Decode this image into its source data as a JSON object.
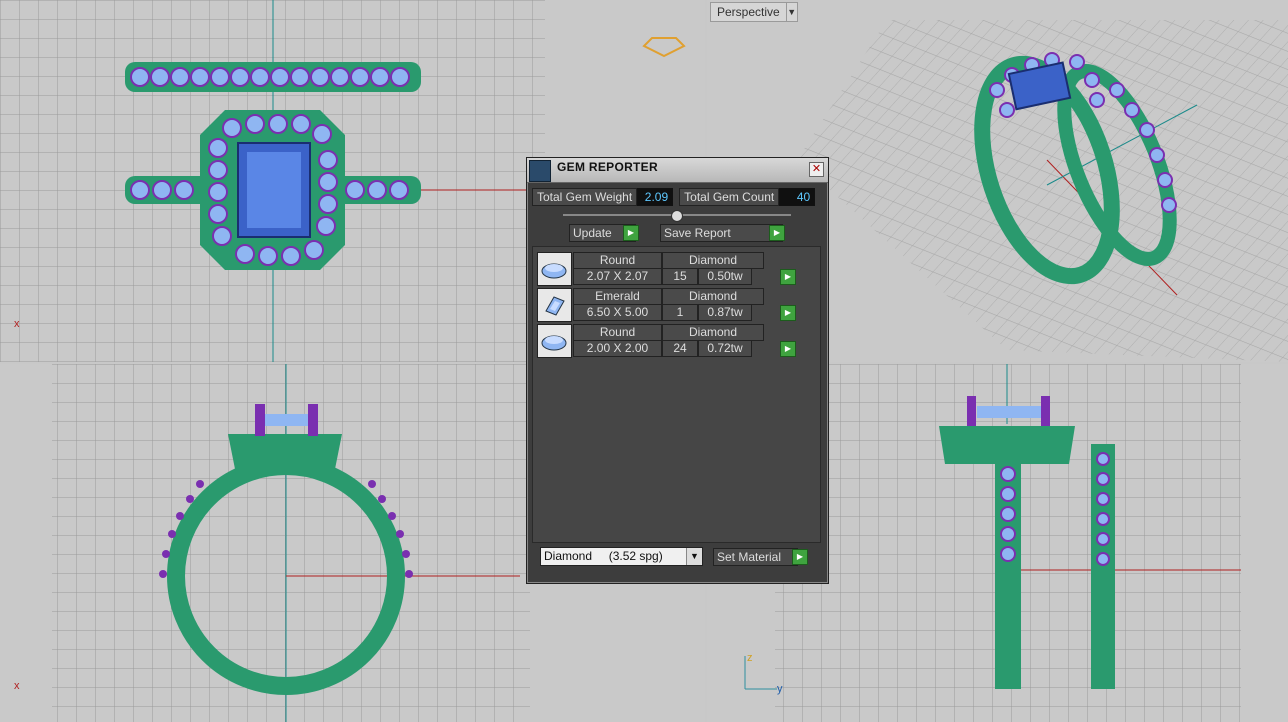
{
  "viewports": {
    "perspective_label": "Perspective",
    "axis_x": "x",
    "axis_y": "y",
    "axis_z": "z"
  },
  "gem_reporter": {
    "title": "GEM REPORTER",
    "total_weight_label": "Total Gem Weight",
    "total_weight_value": "2.09",
    "total_count_label": "Total Gem Count",
    "total_count_value": "40",
    "update_label": "Update",
    "save_report_label": "Save Report",
    "gems": [
      {
        "shape": "Round",
        "material": "Diamond",
        "size": "2.07 X 2.07",
        "count": "15",
        "weight": "0.50tw"
      },
      {
        "shape": "Emerald",
        "material": "Diamond",
        "size": "6.50 X 5.00",
        "count": "1",
        "weight": "0.87tw"
      },
      {
        "shape": "Round",
        "material": "Diamond",
        "size": "2.00 X 2.00",
        "count": "24",
        "weight": "0.72tw"
      }
    ],
    "material_select": "Diamond     (3.52 spg)",
    "set_material_label": "Set Material"
  },
  "colors": {
    "ring_green": "#2a9a6e",
    "stone_light_blue": "#8fb6f2",
    "prong_purple": "#7a2fb0",
    "center_stone_blue": "#5a86e6"
  }
}
